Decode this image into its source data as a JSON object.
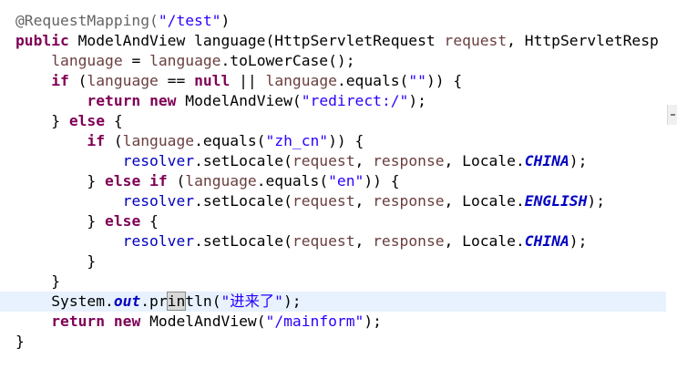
{
  "editor": {
    "lines": [
      [
        {
          "t": "@RequestMapping(",
          "c": "anno"
        },
        {
          "t": "\"/test\"",
          "c": "str"
        },
        {
          "t": ")",
          "c": "plain"
        }
      ],
      [
        {
          "t": "public",
          "c": "kw"
        },
        {
          "t": " ModelAndView language(HttpServletRequest ",
          "c": "plain"
        },
        {
          "t": "request",
          "c": "var"
        },
        {
          "t": ", HttpServletResp",
          "c": "plain"
        }
      ],
      [
        {
          "t": "    ",
          "c": "plain"
        },
        {
          "t": "language",
          "c": "var"
        },
        {
          "t": " = ",
          "c": "plain"
        },
        {
          "t": "language",
          "c": "var"
        },
        {
          "t": ".toLowerCase();",
          "c": "plain"
        }
      ],
      [
        {
          "t": "    ",
          "c": "plain"
        },
        {
          "t": "if",
          "c": "kw"
        },
        {
          "t": " (",
          "c": "plain"
        },
        {
          "t": "language",
          "c": "var"
        },
        {
          "t": " == ",
          "c": "plain"
        },
        {
          "t": "null",
          "c": "kw"
        },
        {
          "t": " || ",
          "c": "plain"
        },
        {
          "t": "language",
          "c": "var"
        },
        {
          "t": ".equals(",
          "c": "plain"
        },
        {
          "t": "\"\"",
          "c": "str"
        },
        {
          "t": ")) {",
          "c": "plain"
        }
      ],
      [
        {
          "t": "        ",
          "c": "plain"
        },
        {
          "t": "return",
          "c": "kw"
        },
        {
          "t": " ",
          "c": "plain"
        },
        {
          "t": "new",
          "c": "kw"
        },
        {
          "t": " ModelAndView(",
          "c": "plain"
        },
        {
          "t": "\"redirect:/\"",
          "c": "str"
        },
        {
          "t": ");",
          "c": "plain"
        }
      ],
      [
        {
          "t": "    } ",
          "c": "plain"
        },
        {
          "t": "else",
          "c": "kw"
        },
        {
          "t": " {",
          "c": "plain"
        }
      ],
      [
        {
          "t": "        ",
          "c": "plain"
        },
        {
          "t": "if",
          "c": "kw"
        },
        {
          "t": " (",
          "c": "plain"
        },
        {
          "t": "language",
          "c": "var"
        },
        {
          "t": ".equals(",
          "c": "plain"
        },
        {
          "t": "\"zh_cn\"",
          "c": "str"
        },
        {
          "t": ")) {",
          "c": "plain"
        }
      ],
      [
        {
          "t": "            ",
          "c": "plain"
        },
        {
          "t": "resolver",
          "c": "field"
        },
        {
          "t": ".setLocale(",
          "c": "plain"
        },
        {
          "t": "request",
          "c": "var"
        },
        {
          "t": ", ",
          "c": "plain"
        },
        {
          "t": "response",
          "c": "var"
        },
        {
          "t": ", Locale.",
          "c": "plain"
        },
        {
          "t": "CHINA",
          "c": "static"
        },
        {
          "t": ");",
          "c": "plain"
        }
      ],
      [
        {
          "t": "        } ",
          "c": "plain"
        },
        {
          "t": "else",
          "c": "kw"
        },
        {
          "t": " ",
          "c": "plain"
        },
        {
          "t": "if",
          "c": "kw"
        },
        {
          "t": " (",
          "c": "plain"
        },
        {
          "t": "language",
          "c": "var"
        },
        {
          "t": ".equals(",
          "c": "plain"
        },
        {
          "t": "\"en\"",
          "c": "str"
        },
        {
          "t": ")) {",
          "c": "plain"
        }
      ],
      [
        {
          "t": "            ",
          "c": "plain"
        },
        {
          "t": "resolver",
          "c": "field"
        },
        {
          "t": ".setLocale(",
          "c": "plain"
        },
        {
          "t": "request",
          "c": "var"
        },
        {
          "t": ", ",
          "c": "plain"
        },
        {
          "t": "response",
          "c": "var"
        },
        {
          "t": ", Locale.",
          "c": "plain"
        },
        {
          "t": "ENGLISH",
          "c": "static"
        },
        {
          "t": ");",
          "c": "plain"
        }
      ],
      [
        {
          "t": "        } ",
          "c": "plain"
        },
        {
          "t": "else",
          "c": "kw"
        },
        {
          "t": " {",
          "c": "plain"
        }
      ],
      [
        {
          "t": "            ",
          "c": "plain"
        },
        {
          "t": "resolver",
          "c": "field"
        },
        {
          "t": ".setLocale(",
          "c": "plain"
        },
        {
          "t": "request",
          "c": "var"
        },
        {
          "t": ", ",
          "c": "plain"
        },
        {
          "t": "response",
          "c": "var"
        },
        {
          "t": ", Locale.",
          "c": "plain"
        },
        {
          "t": "CHINA",
          "c": "static"
        },
        {
          "t": ");",
          "c": "plain"
        }
      ],
      [
        {
          "t": "        }",
          "c": "plain"
        }
      ],
      [
        {
          "t": "    }",
          "c": "plain"
        }
      ],
      [
        {
          "t": "    System.",
          "c": "plain"
        },
        {
          "t": "out",
          "c": "static"
        },
        {
          "t": ".pr",
          "c": "plain"
        },
        {
          "t": "in",
          "c": "match"
        },
        {
          "t": "tln(",
          "c": "plain"
        },
        {
          "t": "\"进来了\"",
          "c": "str"
        },
        {
          "t": ");",
          "c": "plain"
        }
      ],
      [
        {
          "t": "    ",
          "c": "plain"
        },
        {
          "t": "return",
          "c": "kw"
        },
        {
          "t": " ",
          "c": "plain"
        },
        {
          "t": "new",
          "c": "kw"
        },
        {
          "t": " ModelAndView(",
          "c": "plain"
        },
        {
          "t": "\"/mainform\"",
          "c": "str"
        },
        {
          "t": ");",
          "c": "plain"
        }
      ],
      [
        {
          "t": "}",
          "c": "plain"
        }
      ]
    ],
    "current_line_index": 14,
    "colors": {
      "keyword": "#7f0055",
      "string": "#2a00ff",
      "variable": "#6a3e3e",
      "field": "#0000c0",
      "annotation": "#646464",
      "current_line": "#e8f2fe"
    }
  }
}
